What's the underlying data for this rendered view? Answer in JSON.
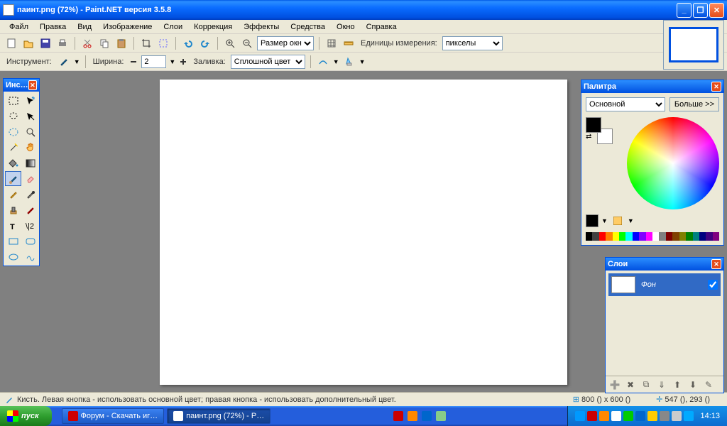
{
  "titlebar": {
    "text": "паинт.png (72%) - Paint.NET версия 3.5.8"
  },
  "menu": [
    "Файл",
    "Правка",
    "Вид",
    "Изображение",
    "Слои",
    "Коррекция",
    "Эффекты",
    "Средства",
    "Окно",
    "Справка"
  ],
  "toolbar1": {
    "zoom_label": "Размер окн",
    "units_label": "Единицы измерения:",
    "units_value": "пикселы"
  },
  "toolbar2": {
    "tool_label": "Инструмент:",
    "width_label": "Ширина:",
    "width_value": "2",
    "fill_label": "Заливка:",
    "fill_value": "Сплошной цвет"
  },
  "tools_panel": {
    "title": "Инс…"
  },
  "palette": {
    "title": "Палитра",
    "mode": "Основной",
    "more": "Больше >>",
    "strip": [
      "#000000",
      "#404040",
      "#ff0000",
      "#ff8000",
      "#ffff00",
      "#00ff00",
      "#00ffff",
      "#0000ff",
      "#8000ff",
      "#ff00ff",
      "#ffffff",
      "#808080",
      "#800000",
      "#804000",
      "#808000",
      "#008000",
      "#008080",
      "#000080",
      "#400080",
      "#800080"
    ]
  },
  "layers": {
    "title": "Слои",
    "layer_name": "Фон"
  },
  "status": {
    "hint": "Кисть. Левая кнопка - использовать основной цвет; правая кнопка - использовать дополнительный цвет.",
    "dims": "800 () x 600 ()",
    "cursor": "547 (), 293 ()"
  },
  "taskbar": {
    "start": "пуск",
    "task1": "Форум - Скачать иг…",
    "task2": "паинт.png (72%) - P…",
    "clock": "14:13"
  }
}
